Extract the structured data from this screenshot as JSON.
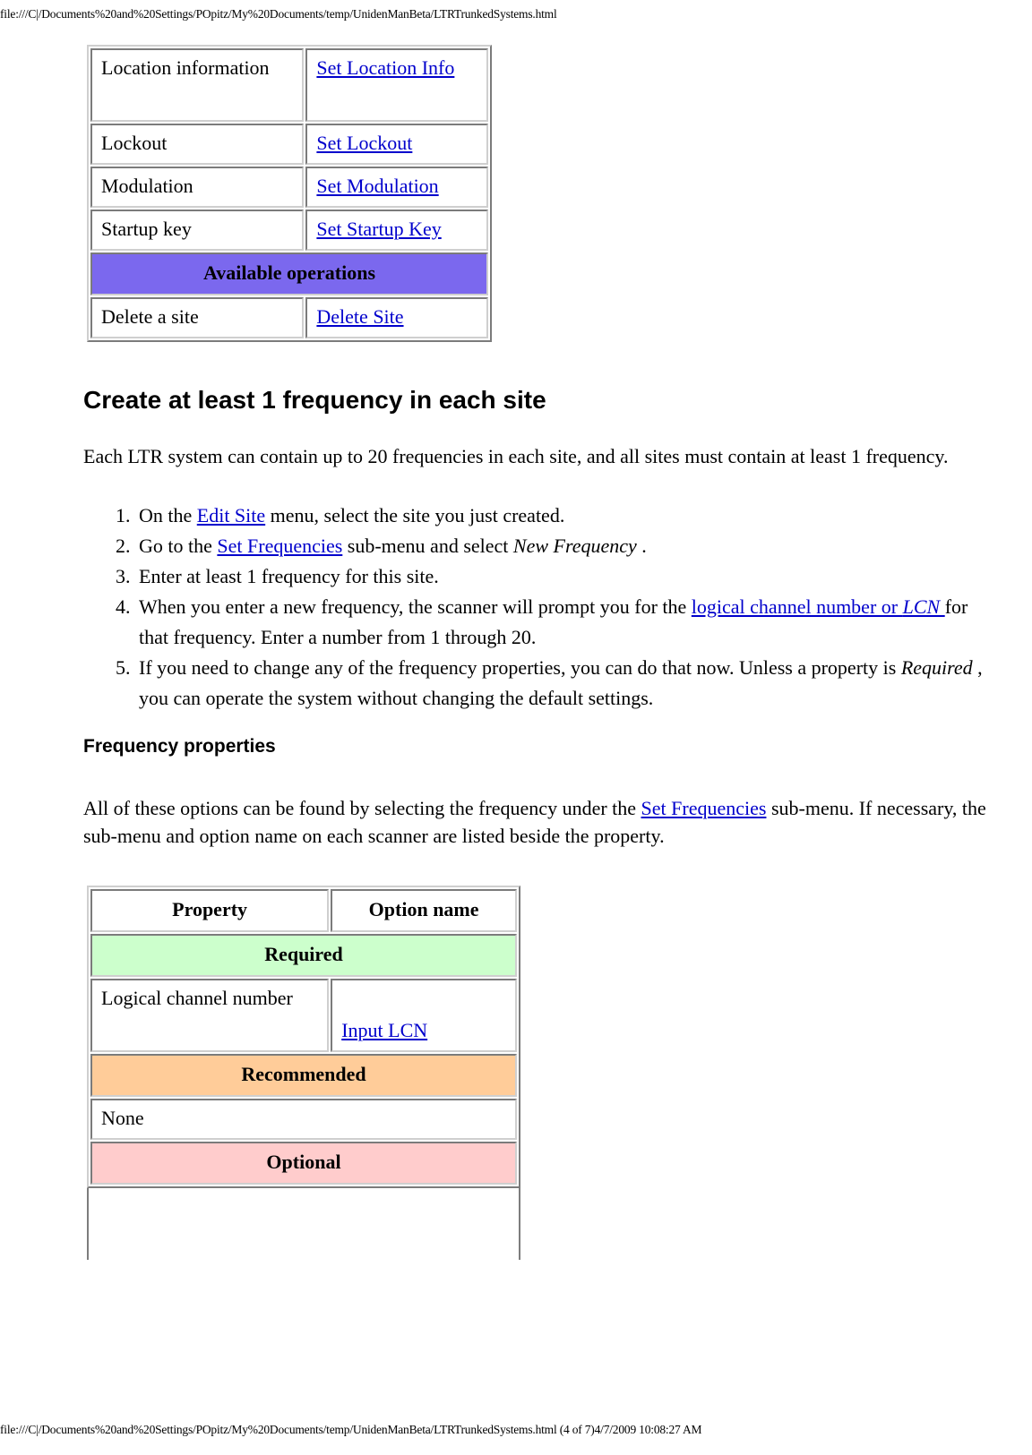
{
  "document": {
    "header_url": "file:///C|/Documents%20and%20Settings/POpitz/My%20Documents/temp/UnidenManBeta/LTRTrunkedSystems.html",
    "footer_url": "file:///C|/Documents%20and%20Settings/POpitz/My%20Documents/temp/UnidenManBeta/LTRTrunkedSystems.html (4 of 7)4/7/2009 10:08:27 AM"
  },
  "colors": {
    "link": "#0000cc",
    "available_operations_bg": "#7b68ee",
    "required_bg": "#ccffcc",
    "recommended_bg": "#ffcc99",
    "optional_bg": "#ffcccc",
    "table_border": "#cfcfcf"
  },
  "site_options_table": {
    "rows": [
      {
        "type": "pair",
        "property": "Location information",
        "option": "Set Location Info",
        "option_is_link": true,
        "tall": true
      },
      {
        "type": "pair",
        "property": "Lockout",
        "option": "Set Lockout",
        "option_is_link": true,
        "tall": false
      },
      {
        "type": "pair",
        "property": "Modulation",
        "option": "Set Modulation",
        "option_is_link": true,
        "tall": false
      },
      {
        "type": "pair",
        "property": "Startup key",
        "option": "Set Startup Key",
        "option_is_link": true,
        "tall": false
      },
      {
        "type": "banner",
        "label": "Available operations",
        "bg": "#7b68ee"
      },
      {
        "type": "pair",
        "property": "Delete a site",
        "option": "Delete Site",
        "option_is_link": true,
        "tall": false
      }
    ]
  },
  "section_create_frequency": {
    "heading": "Create at least 1 frequency in each site",
    "intro": "Each LTR system can contain up to 20 frequencies in each site, and all sites must contain at least 1 frequency.",
    "steps": [
      {
        "parts": [
          {
            "text": "On the "
          },
          {
            "text": "Edit Site",
            "link": true
          },
          {
            "text": " menu, select the site you just created."
          }
        ]
      },
      {
        "parts": [
          {
            "text": "Go to the "
          },
          {
            "text": "Set Frequencies",
            "link": true
          },
          {
            "text": " sub-menu and select "
          },
          {
            "text": "New Frequency",
            "italic": true
          },
          {
            "text": " ."
          }
        ]
      },
      {
        "parts": [
          {
            "text": "Enter at least 1 frequency for this site."
          }
        ]
      },
      {
        "parts": [
          {
            "text": "When you enter a new frequency, the scanner will prompt you for the "
          },
          {
            "text": "logical channel number or ",
            "link": true
          },
          {
            "text": "LCN ",
            "link": true,
            "italic": true
          },
          {
            "text": "for that frequency. Enter a number from 1 through 20."
          }
        ]
      },
      {
        "parts": [
          {
            "text": "If you need to change any of the frequency properties, you can do that now. Unless a property is "
          },
          {
            "text": "Required",
            "italic": true
          },
          {
            "text": " , you can operate the system without changing the default settings."
          }
        ]
      }
    ]
  },
  "section_frequency_properties": {
    "heading": "Frequency properties",
    "intro_parts": [
      {
        "text": "All of these options can be found by selecting the frequency under the "
      },
      {
        "text": "Set Frequencies",
        "link": true
      },
      {
        "text": " sub-menu. If necessary, the sub-menu and option name on each scanner are listed beside the property."
      }
    ]
  },
  "frequency_properties_table": {
    "headers": {
      "property": "Property",
      "option": "Option name"
    },
    "rows": [
      {
        "type": "banner",
        "label": "Required",
        "bg": "#ccffcc"
      },
      {
        "type": "pair",
        "property": "Logical channel number",
        "option": "Input LCN",
        "option_is_link": true,
        "tall": true
      },
      {
        "type": "banner",
        "label": "Recommended",
        "bg": "#ffcc99"
      },
      {
        "type": "full",
        "label": "None"
      },
      {
        "type": "banner",
        "label": "Optional",
        "bg": "#ffcccc"
      }
    ]
  }
}
